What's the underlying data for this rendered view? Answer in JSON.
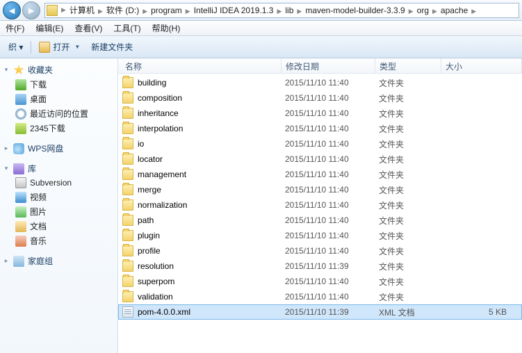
{
  "breadcrumb": [
    "计算机",
    "软件 (D:)",
    "program",
    "IntelliJ IDEA 2019.1.3",
    "lib",
    "maven-model-builder-3.3.9",
    "org",
    "apache"
  ],
  "menus": {
    "file": "件(F)",
    "edit": "编辑(E)",
    "view": "查看(V)",
    "tools": "工具(T)",
    "help": "帮助(H)"
  },
  "toolbar": {
    "organize": "织 ▾",
    "open": "打开",
    "newfolder": "新建文件夹"
  },
  "sidebar": {
    "fav": {
      "head": "收藏夹",
      "items": [
        "下载",
        "桌面",
        "最近访问的位置",
        "2345下载"
      ]
    },
    "wps": {
      "head": "WPS网盘"
    },
    "lib": {
      "head": "库",
      "items": [
        "Subversion",
        "视频",
        "图片",
        "文档",
        "音乐"
      ]
    },
    "home": {
      "head": "家庭组"
    }
  },
  "columns": {
    "name": "名称",
    "date": "修改日期",
    "type": "类型",
    "size": "大小"
  },
  "files": [
    {
      "name": "building",
      "date": "2015/11/10 11:40",
      "type": "文件夹",
      "size": "",
      "kind": "folder"
    },
    {
      "name": "composition",
      "date": "2015/11/10 11:40",
      "type": "文件夹",
      "size": "",
      "kind": "folder"
    },
    {
      "name": "inheritance",
      "date": "2015/11/10 11:40",
      "type": "文件夹",
      "size": "",
      "kind": "folder"
    },
    {
      "name": "interpolation",
      "date": "2015/11/10 11:40",
      "type": "文件夹",
      "size": "",
      "kind": "folder"
    },
    {
      "name": "io",
      "date": "2015/11/10 11:40",
      "type": "文件夹",
      "size": "",
      "kind": "folder"
    },
    {
      "name": "locator",
      "date": "2015/11/10 11:40",
      "type": "文件夹",
      "size": "",
      "kind": "folder"
    },
    {
      "name": "management",
      "date": "2015/11/10 11:40",
      "type": "文件夹",
      "size": "",
      "kind": "folder"
    },
    {
      "name": "merge",
      "date": "2015/11/10 11:40",
      "type": "文件夹",
      "size": "",
      "kind": "folder"
    },
    {
      "name": "normalization",
      "date": "2015/11/10 11:40",
      "type": "文件夹",
      "size": "",
      "kind": "folder"
    },
    {
      "name": "path",
      "date": "2015/11/10 11:40",
      "type": "文件夹",
      "size": "",
      "kind": "folder"
    },
    {
      "name": "plugin",
      "date": "2015/11/10 11:40",
      "type": "文件夹",
      "size": "",
      "kind": "folder"
    },
    {
      "name": "profile",
      "date": "2015/11/10 11:40",
      "type": "文件夹",
      "size": "",
      "kind": "folder"
    },
    {
      "name": "resolution",
      "date": "2015/11/10 11:39",
      "type": "文件夹",
      "size": "",
      "kind": "folder"
    },
    {
      "name": "superpom",
      "date": "2015/11/10 11:40",
      "type": "文件夹",
      "size": "",
      "kind": "folder"
    },
    {
      "name": "validation",
      "date": "2015/11/10 11:40",
      "type": "文件夹",
      "size": "",
      "kind": "folder"
    },
    {
      "name": "pom-4.0.0.xml",
      "date": "2015/11/10 11:39",
      "type": "XML 文档",
      "size": "5 KB",
      "kind": "xml",
      "selected": true
    }
  ]
}
